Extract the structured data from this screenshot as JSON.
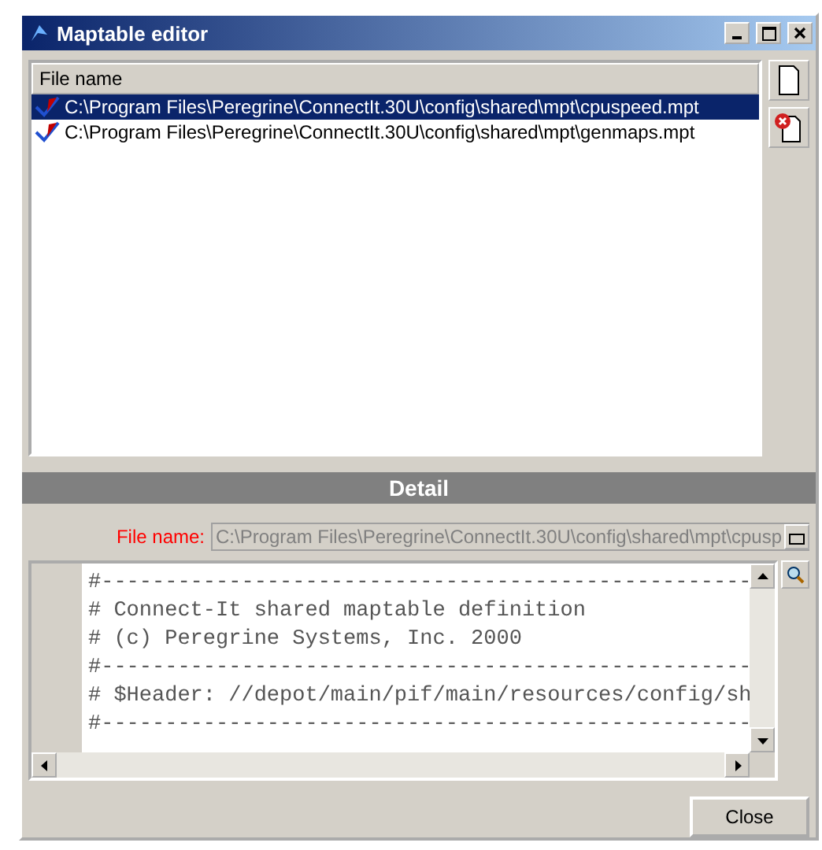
{
  "window": {
    "title": "Maptable editor"
  },
  "file_list": {
    "column": "File name",
    "rows": [
      {
        "path": "C:\\Program Files\\Peregrine\\ConnectIt.30U\\config\\shared\\mpt\\cpuspeed.mpt",
        "selected": true
      },
      {
        "path": "C:\\Program Files\\Peregrine\\ConnectIt.30U\\config\\shared\\mpt\\genmaps.mpt",
        "selected": false
      }
    ]
  },
  "detail": {
    "title": "Detail",
    "file_label": "File name:",
    "file_value": "C:\\Program Files\\Peregrine\\ConnectIt.30U\\config\\shared\\mpt\\cpusp",
    "code_lines": [
      "#---------------------------------------------------",
      "# Connect-It shared maptable definition",
      "# (c) Peregrine Systems, Inc. 2000",
      "#---------------------------------------------------",
      "# $Header: //depot/main/pif/main/resources/config/sh",
      "#---------------------------------------------------"
    ]
  },
  "buttons": [
    "Close"
  ]
}
